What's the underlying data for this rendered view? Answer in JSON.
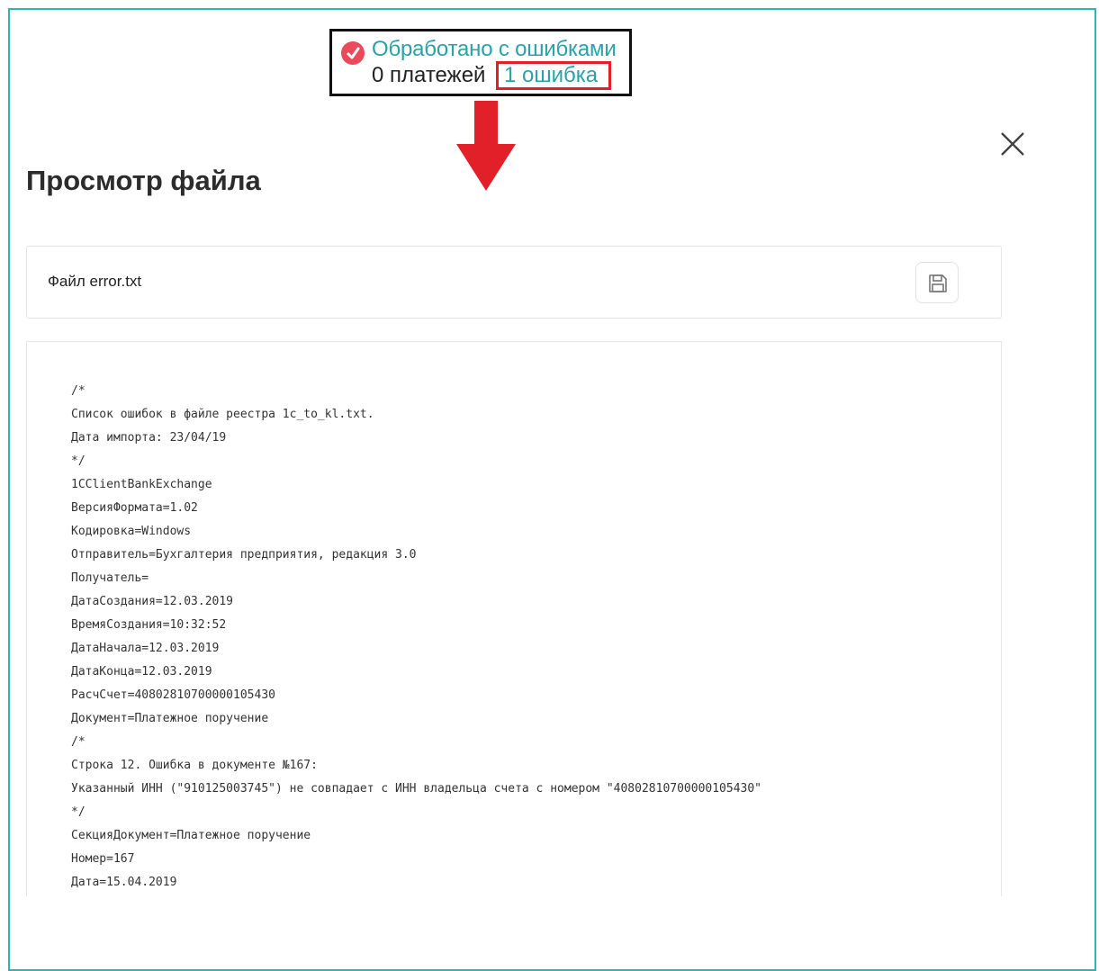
{
  "callout": {
    "status_text": "Обработано с ошибками",
    "payments_text": "0 платежей",
    "errors_link": "1 ошибка",
    "status_icon": "error-check-icon",
    "status_color": "#2aa3a8",
    "error_color": "#e2202a"
  },
  "modal": {
    "title": "Просмотр файла",
    "close_icon": "close-icon",
    "file_label": "Файл error.txt",
    "save_icon": "save-icon"
  },
  "file_content": {
    "lines": [
      "/*",
      "Список ошибок в файле реестра 1c_to_kl.txt.",
      "Дата импорта: 23/04/19",
      "*/",
      "1CClientBankExchange",
      "ВерсияФормата=1.02",
      "Кодировка=Windows",
      "Отправитель=Бухгалтерия предприятия, редакция 3.0",
      "Получатель=",
      "ДатаСоздания=12.03.2019",
      "ВремяСоздания=10:32:52",
      "ДатаНачала=12.03.2019",
      "ДатаКонца=12.03.2019",
      "РасчСчет=40802810700000105430",
      "Документ=Платежное поручение",
      "/*",
      "Строка 12. Ошибка в документе №167:",
      "Указанный ИНН (\"910125003745\") не совпадает с ИНН владельца счета с номером \"40802810700000105430\"",
      "*/",
      "СекцияДокумент=Платежное поручение",
      "Номер=167",
      "Дата=15.04.2019"
    ]
  }
}
